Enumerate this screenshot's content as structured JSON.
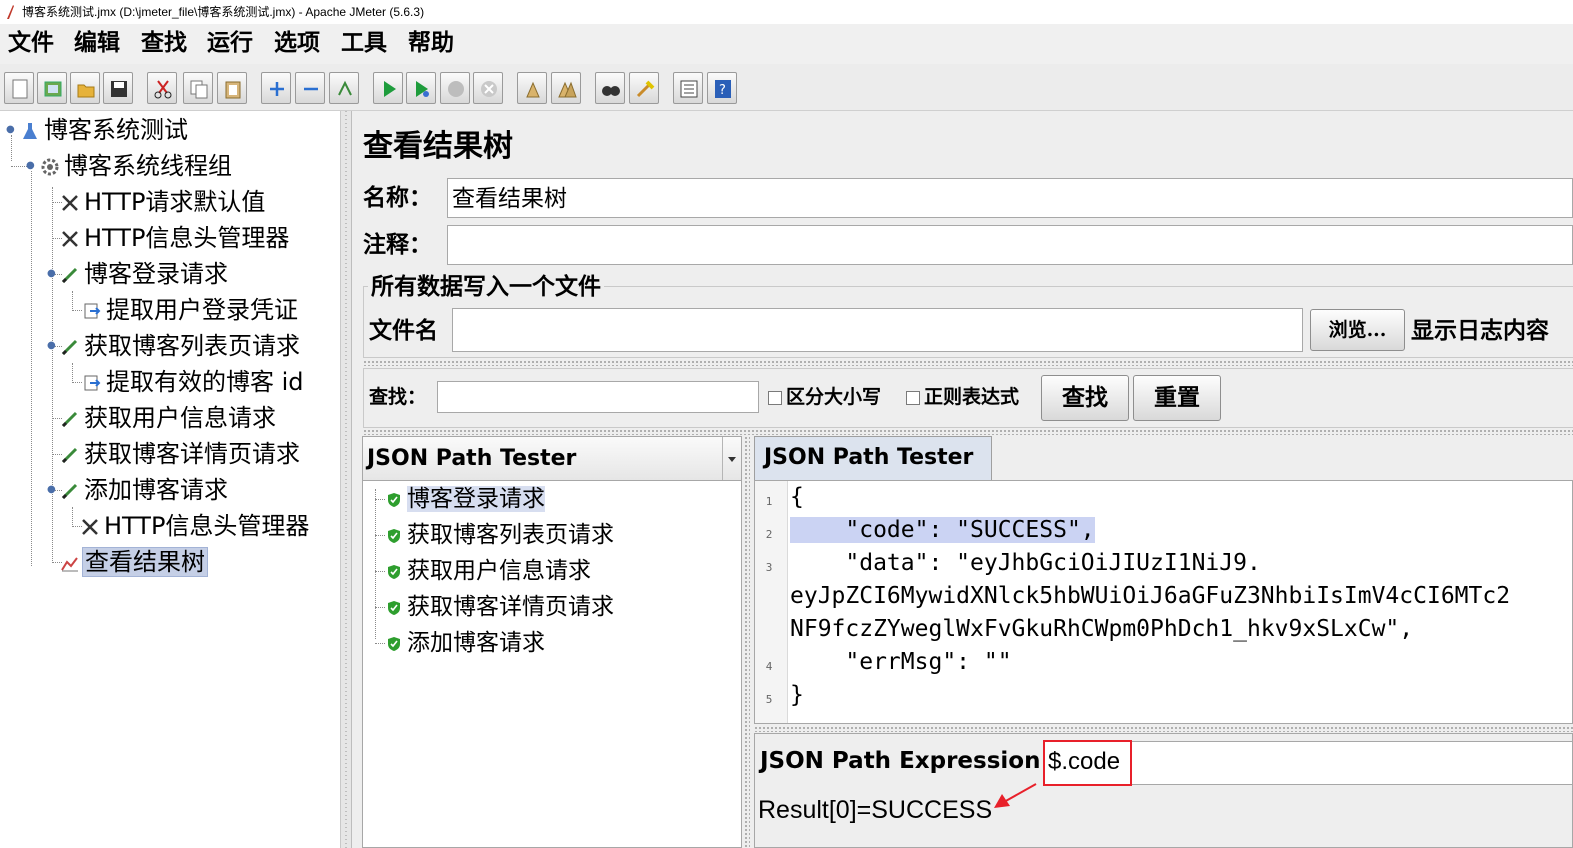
{
  "window": {
    "title": "博客系统测试.jmx (D:\\jmeter_file\\博客系统测试.jmx) - Apache JMeter (5.6.3)"
  },
  "menu": [
    "文件",
    "编辑",
    "查找",
    "运行",
    "选项",
    "工具",
    "帮助"
  ],
  "toolbar": {
    "icons": [
      "new-icon",
      "templates-icon",
      "open-icon",
      "save-icon",
      "cut-icon",
      "copy-icon",
      "paste-icon",
      "expand-icon",
      "collapse-icon",
      "toggle-icon",
      "start-icon",
      "start-no-pause-icon",
      "stop-icon",
      "shutdown-icon",
      "clear-icon",
      "clear-all-icon",
      "search-icon",
      "reset-search-icon",
      "function-helper-icon",
      "help-icon"
    ]
  },
  "tree": {
    "items": [
      {
        "label": "博客系统测试",
        "icon": "test-plan-icon"
      },
      {
        "label": "博客系统线程组",
        "icon": "thread-group-icon"
      },
      {
        "label": "HTTP请求默认值",
        "icon": "config-element-icon"
      },
      {
        "label": "HTTP信息头管理器",
        "icon": "config-element-icon"
      },
      {
        "label": "博客登录请求",
        "icon": "sampler-icon"
      },
      {
        "label": "提取用户登录凭证",
        "icon": "post-processor-icon"
      },
      {
        "label": "获取博客列表页请求",
        "icon": "sampler-icon"
      },
      {
        "label": "提取有效的博客 id",
        "icon": "post-processor-icon"
      },
      {
        "label": "获取用户信息请求",
        "icon": "sampler-icon"
      },
      {
        "label": "获取博客详情页请求",
        "icon": "sampler-icon"
      },
      {
        "label": "添加博客请求",
        "icon": "sampler-icon"
      },
      {
        "label": "HTTP信息头管理器",
        "icon": "config-element-icon"
      },
      {
        "label": "查看结果树",
        "icon": "listener-icon"
      }
    ]
  },
  "panel": {
    "heading": "查看结果树",
    "name_label": "名称：",
    "name_value": "查看结果树",
    "comment_label": "注释：",
    "comment_value": "",
    "file_section": "所有数据写入一个文件",
    "filename_label": "文件名",
    "filename_value": "",
    "browse_button": "浏览...",
    "log_label": "显示日志内容"
  },
  "search": {
    "label": "查找：",
    "value": "",
    "case_sensitive": "区分大小写",
    "regex": "正则表达式",
    "find_button": "查找",
    "reset_button": "重置"
  },
  "renderer": {
    "selected": "JSON Path Tester",
    "results": [
      {
        "label": "博客登录请求",
        "status": "success"
      },
      {
        "label": "获取博客列表页请求",
        "status": "success"
      },
      {
        "label": "获取用户信息请求",
        "status": "success"
      },
      {
        "label": "获取博客详情页请求",
        "status": "success"
      },
      {
        "label": "添加博客请求",
        "status": "success"
      }
    ]
  },
  "tester": {
    "tab": "JSON Path Tester",
    "line_numbers": [
      "1",
      "2",
      "3",
      "4",
      "5"
    ],
    "lines": [
      "{",
      "    \"code\": \"SUCCESS\",",
      "    \"data\": \"eyJhbGciOiJIUzI1NiJ9.",
      "eyJpZCI6MywidXNlck5hbWUiOiJ6aGFuZ3NhbiIsImV4cCI6MTc2",
      "NF9fczZYweglWxFvGkuRhCWpm0PhDch1_hkv9xSLxCw\",",
      "    \"errMsg\": \"\"",
      "}"
    ],
    "expression_label": "JSON Path Expression",
    "expression_value": "$.code",
    "result": "Result[0]=SUCCESS"
  },
  "colors": {
    "selection": "#c5cfe6",
    "highlight": "#cbd3f3",
    "annotation": "#e8202a",
    "success": "#2e9e2e"
  }
}
